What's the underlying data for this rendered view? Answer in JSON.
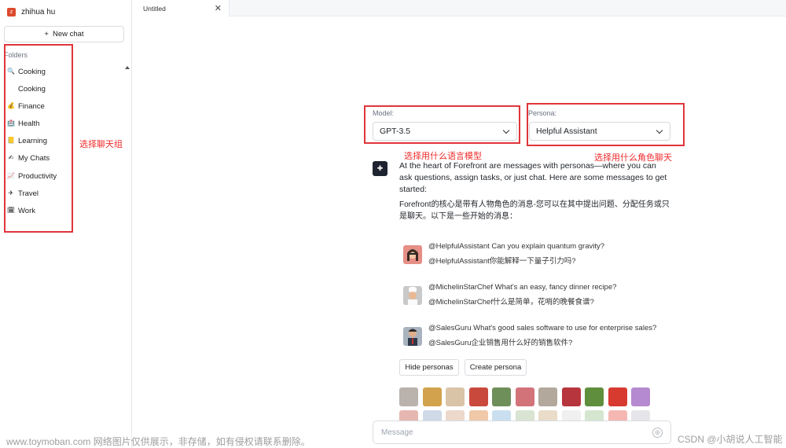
{
  "sidebar": {
    "user_initial": "z",
    "user_name": "zhihua hu",
    "new_chat_icon": "+",
    "new_chat_label": "New chat",
    "folders_title": "Folders",
    "folders": [
      {
        "label": "Cooking",
        "icon": "magnifier-icon",
        "glyph": "🔍"
      },
      {
        "label": "Cooking",
        "icon": "",
        "glyph": ""
      },
      {
        "label": "Finance",
        "icon": "money-bag-icon",
        "glyph": "💰"
      },
      {
        "label": "Health",
        "icon": "clipboard-icon",
        "glyph": "🏥"
      },
      {
        "label": "Learning",
        "icon": "notebook-icon",
        "glyph": "📒"
      },
      {
        "label": "My Chats",
        "icon": "pencil-icon",
        "glyph": "✍"
      },
      {
        "label": "Productivity",
        "icon": "chart-icon",
        "glyph": "📈"
      },
      {
        "label": "Travel",
        "icon": "airplane-icon",
        "glyph": "✈"
      },
      {
        "label": "Work",
        "icon": "calendar-icon",
        "glyph": "🗓"
      }
    ]
  },
  "tabs": [
    {
      "label": "Untitled",
      "close": "✕"
    }
  ],
  "model": {
    "label": "Model:",
    "value": "GPT-3.5"
  },
  "persona": {
    "label": "Persona:",
    "value": "Helpful Assistant"
  },
  "intro": {
    "logo_glyph": "✚",
    "text_en": "At the heart of Forefront are messages with personas—where you can ask questions, assign tasks, or just chat. Here are some messages to get started:",
    "text_cn": "Forefront的核心是带有人物角色的消息-您可以在其中提出问题、分配任务或只是聊天。以下是一些开始的消息："
  },
  "samples": [
    {
      "en": "@HelpfulAssistant Can you explain quantum gravity?",
      "cn": "@HelpfulAssistant你能解释一下量子引力吗?",
      "avatar_color": "#e58f86"
    },
    {
      "en": "@MichelinStarChef What's an easy, fancy dinner recipe?",
      "cn": "@MichelinStarChef什么是简单，花哨的晚餐食谱?",
      "avatar_color": "#c9c9c9"
    },
    {
      "en": "@SalesGuru What's good sales software to use for enterprise sales?",
      "cn": "@SalesGuru企业销售用什么好的销售软件?",
      "avatar_color": "#a9b3bf"
    }
  ],
  "buttons": {
    "hide_personas": "Hide personas",
    "create_persona": "Create persona"
  },
  "persona_avatar_colors": [
    [
      "#b9b2ad",
      "#d3a24d",
      "#d9c4a7",
      "#c94a3c",
      "#6f8f5a",
      "#d2737a",
      "#b3a89c",
      "#b7353d",
      "#5f8f3d",
      "#d73a2f",
      "#b58ad0"
    ],
    [
      "#e6b7b0",
      "#cfd9e8",
      "#ecd9cc",
      "#f0c9a9",
      "#c9dff0",
      "#d9e4d2",
      "#e9dcc9",
      "#f0f0f0",
      "#d4e6cf",
      "#f4b7b2",
      "#e6e6ea"
    ]
  ],
  "message": {
    "placeholder": "Message",
    "send_icon": "⊕"
  },
  "annotations": {
    "folders_note": "选择聊天组",
    "model_note": "选择用什么语言模型",
    "persona_note": "选择用什么角色聊天"
  },
  "watermarks": {
    "left": "www.toymoban.com 网络图片仅供展示，非存储，如有侵权请联系删除。",
    "right": "CSDN @小胡说人工智能"
  }
}
